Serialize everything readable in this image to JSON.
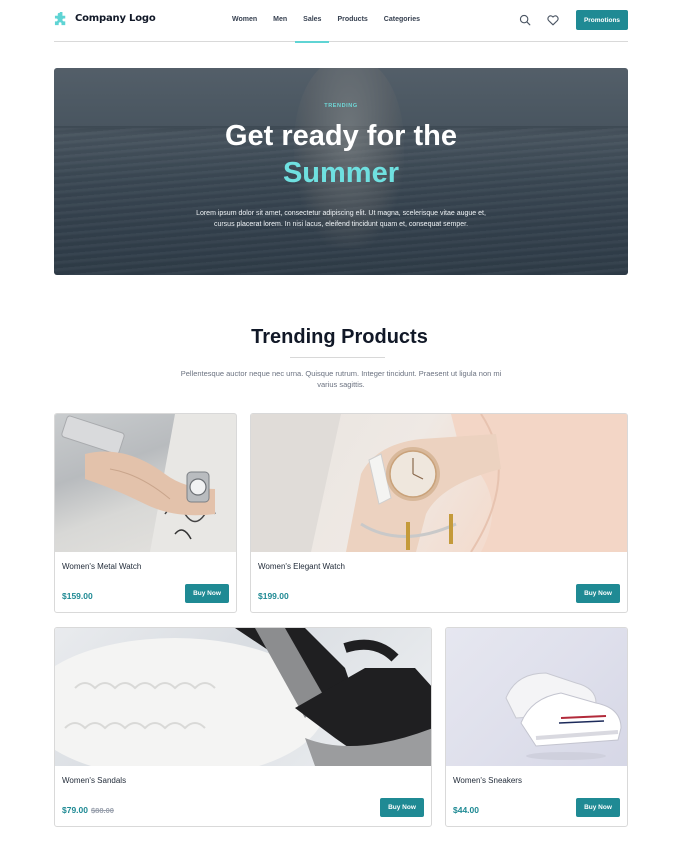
{
  "nav": {
    "logo_text": "Company Logo",
    "links": [
      "Women",
      "Men",
      "Sales",
      "Products",
      "Categories"
    ],
    "active_link": "Sales",
    "promotions_label": "Promotions"
  },
  "hero": {
    "tag": "TRENDING",
    "title_line1": "Get ready for the",
    "title_line2": "Summer",
    "description": "Lorem ipsum dolor sit amet, consectetur adipiscing elit. Ut magna, scelerisque vitae augue et, cursus placerat lorem. In nisi lacus, eleifend tincidunt quam et, consequat semper."
  },
  "section": {
    "title": "Trending Products",
    "description": "Pellentesque auctor neque nec urna. Quisque rutrum. Integer tincidunt. Praesent ut ligula non mi varius sagittis."
  },
  "products": [
    {
      "name": "Women's Metal Watch",
      "price": "$159.00",
      "old_price": "",
      "button": "Buy Now"
    },
    {
      "name": "Women's Elegant Watch",
      "price": "$199.00",
      "old_price": "",
      "button": "Buy Now"
    },
    {
      "name": "Women's Sandals",
      "price": "$79.00",
      "old_price": "$88.00",
      "button": "Buy Now"
    },
    {
      "name": "Women's Sneakers",
      "price": "$44.00",
      "old_price": "",
      "button": "Buy Now"
    }
  ],
  "colors": {
    "accent": "#1f8a94",
    "highlight": "#6fe0e0"
  }
}
